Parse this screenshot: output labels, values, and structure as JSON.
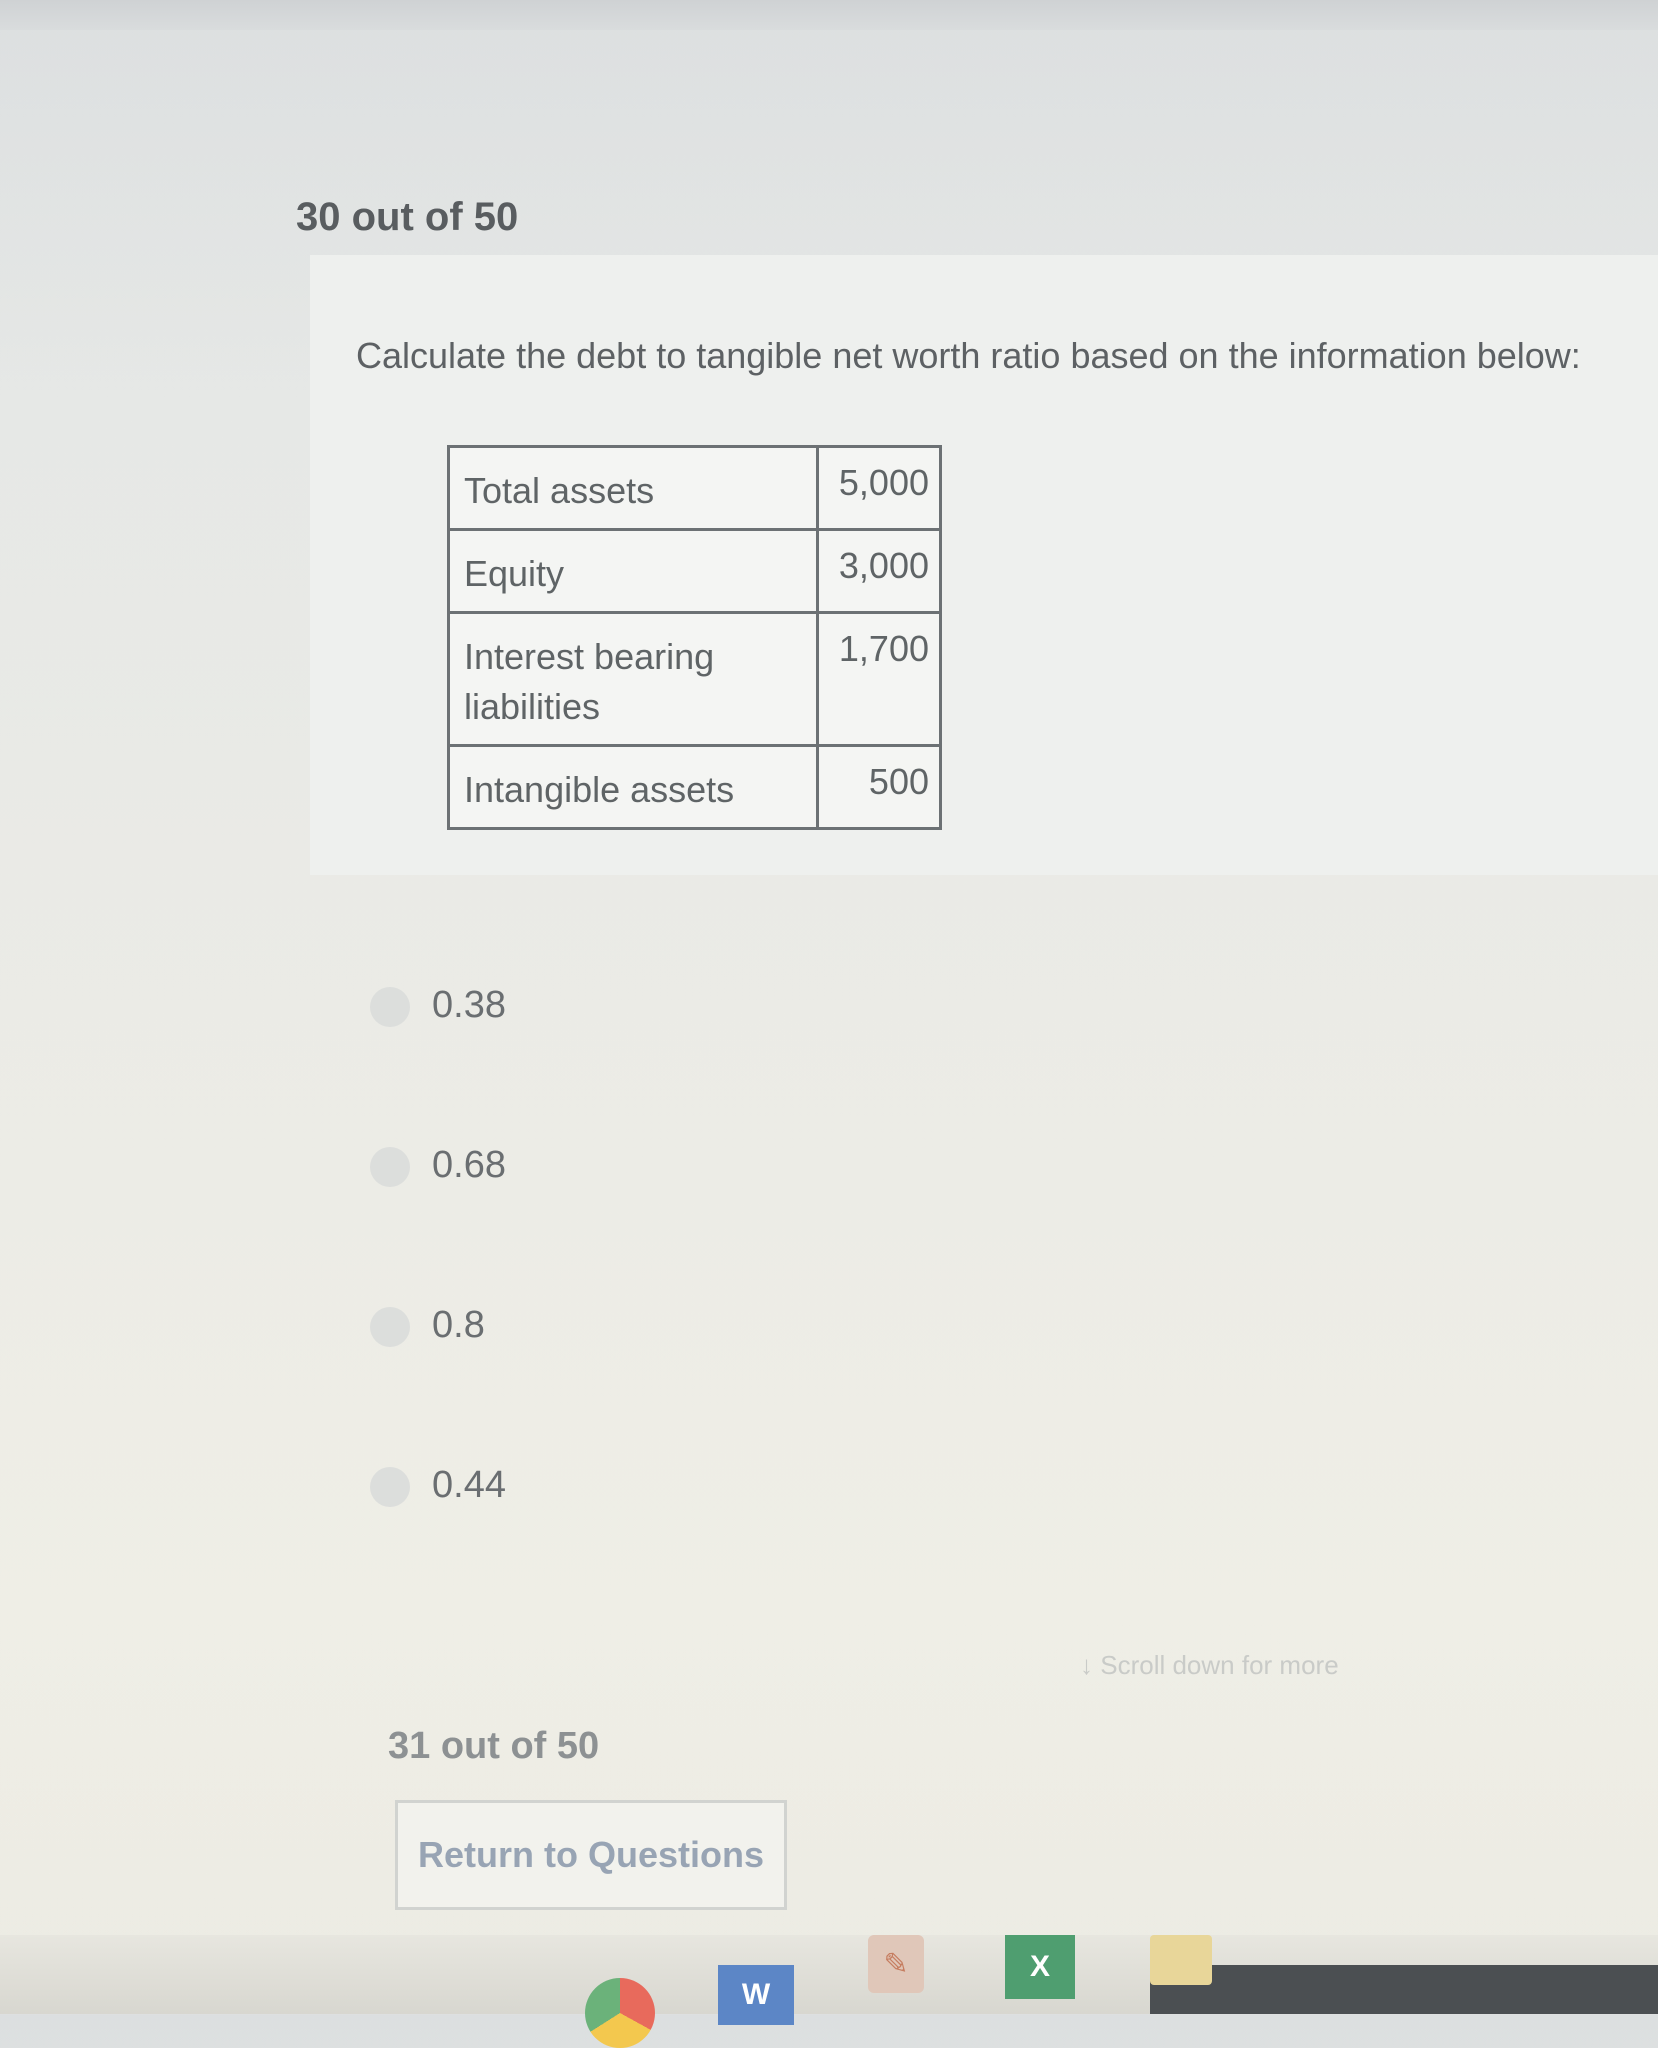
{
  "question": {
    "number_label": "30 out of 50",
    "text": "Calculate the debt to tangible net worth ratio based on the information below:",
    "table": [
      {
        "label": "Total assets",
        "value": "5,000"
      },
      {
        "label": "Equity",
        "value": "3,000"
      },
      {
        "label": "Interest bearing liabilities",
        "value": "1,700"
      },
      {
        "label": "Intangible assets",
        "value": "500"
      }
    ]
  },
  "answers": [
    {
      "label": "0.38"
    },
    {
      "label": "0.68"
    },
    {
      "label": "0.8"
    },
    {
      "label": "0.44"
    }
  ],
  "scroll_hint": "Scroll down for more",
  "next_question_label": "31 out of 50",
  "return_button_label": "Return to Questions",
  "taskbar": {
    "icons": [
      "chrome-icon",
      "word-icon",
      "files-icon",
      "excel-icon",
      "folder-icon"
    ],
    "word_letter": "W",
    "excel_letter": "X"
  },
  "colors": {
    "background": "#ebebe6",
    "text": "#5a5f62",
    "button_text": "#98a4b4"
  }
}
